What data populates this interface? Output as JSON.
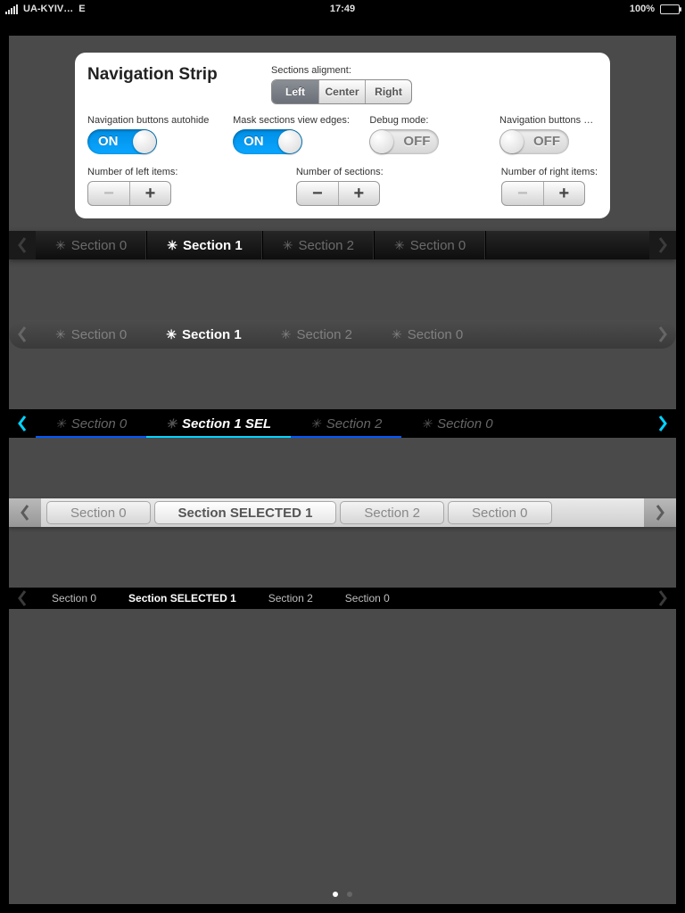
{
  "statusbar": {
    "carrier": "UA-KYIV…",
    "net": "E",
    "time": "17:49",
    "battery": "100%"
  },
  "panel": {
    "title": "Navigation Strip",
    "alignment_label": "Sections aligment:",
    "alignment": {
      "left": "Left",
      "center": "Center",
      "right": "Right",
      "selected": "Left"
    },
    "autohide_label": "Navigation buttons autohide",
    "autohide_value": "ON",
    "mask_label": "Mask sections view edges:",
    "mask_value": "ON",
    "debug_label": "Debug mode:",
    "debug_value": "OFF",
    "hide_label": "Navigation buttons hid…",
    "hide_value": "OFF",
    "left_items_label": "Number of left items:",
    "sections_label": "Number of sections:",
    "right_items_label": "Number of right items:"
  },
  "strips": {
    "s1": [
      "Section 0",
      "Section 1",
      "Section 2",
      "Section 0"
    ],
    "s2": [
      "Section 0",
      "Section 1",
      "Section 2",
      "Section 0"
    ],
    "s3": [
      "Section 0",
      "Section 1 SEL",
      "Section 2",
      "Section 0"
    ],
    "s4": [
      "Section 0",
      "Section SELECTED 1",
      "Section 2",
      "Section 0"
    ],
    "s5": [
      "Section 0",
      "Section SELECTED 1",
      "Section 2",
      "Section 0"
    ]
  },
  "glyphs": {
    "ast": "✳",
    "minus": "−",
    "plus": "+"
  }
}
